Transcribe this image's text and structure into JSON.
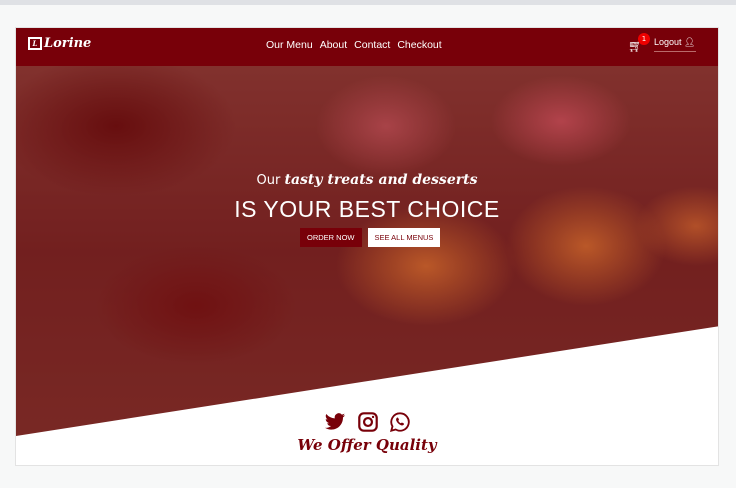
{
  "brand": {
    "name": "Lorine",
    "logo_mark": "L"
  },
  "nav": {
    "items": [
      "Our Menu",
      "About",
      "Contact",
      "Checkout"
    ],
    "cart_count": "1",
    "logout": "Logout"
  },
  "hero": {
    "sub_plain": "Our",
    "sub_script": "tasty treats and desserts",
    "title": "IS YOUR BEST CHOICE",
    "order_now": "ORDER NOW",
    "see_all": "SEE ALL MENUS"
  },
  "colors": {
    "brand": "#780009"
  },
  "social": [
    "twitter-icon",
    "instagram-icon",
    "whatsapp-icon"
  ],
  "section": {
    "title": "We Offer Quality"
  }
}
